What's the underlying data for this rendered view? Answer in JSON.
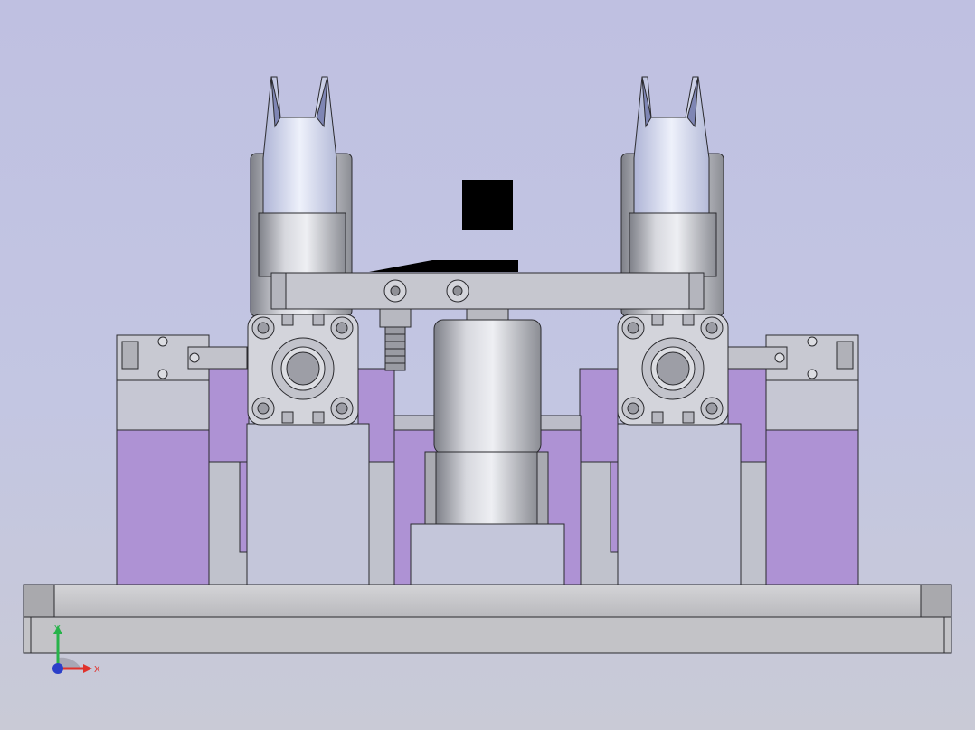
{
  "viewport": {
    "background_top": "#bfc0e1",
    "background_bottom": "#c9cad6"
  },
  "colors": {
    "base_plate": "#c9c9cc",
    "purple_block": "#ae92d4",
    "steel_light": "#c6c7cf",
    "steel_dark": "#8f9096",
    "cylinder_body": "#c0c2c8",
    "gripper_jaw": "#dfe4f6",
    "outline": "#2a2a2e",
    "axis_x": "#e0322c",
    "axis_y": "#27b34a",
    "axis_origin": "#2b3fc9"
  },
  "triad": {
    "x_label": "X",
    "y_label": "Y",
    "icon": "coordinate-triad-icon"
  }
}
